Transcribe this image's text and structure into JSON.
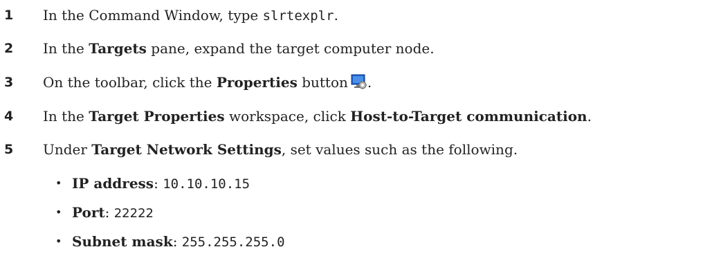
{
  "steps": [
    {
      "number": "1",
      "pre": "In the Command Window, type ",
      "code": "slrtexplr",
      "post": "."
    },
    {
      "number": "2",
      "pre": "In the ",
      "bold": "Targets",
      "post": " pane, expand the target computer node."
    },
    {
      "number": "3",
      "pre": "On the toolbar, click the ",
      "bold": "Properties",
      "post": " button",
      "icon": "properties-icon",
      "after_icon": "."
    },
    {
      "number": "4",
      "pre": "In the ",
      "bold": "Target Properties",
      "mid": " workspace, click ",
      "bold2": "Host-to-Target communication",
      "post": "."
    },
    {
      "number": "5",
      "pre": "Under ",
      "bold": "Target Network Settings",
      "post": ", set values such as the following."
    }
  ],
  "bullets": [
    {
      "marker": "•",
      "label": "IP address",
      "sep": ": ",
      "value": "10.10.10.15"
    },
    {
      "marker": "•",
      "label": "Port",
      "sep": ": ",
      "value": "22222"
    },
    {
      "marker": "•",
      "label": "Subnet mask",
      "sep": ": ",
      "value": "255.255.255.0"
    }
  ]
}
